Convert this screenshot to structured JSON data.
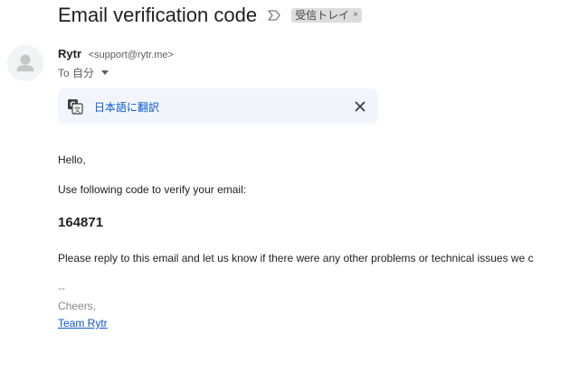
{
  "subject": "Email verification code",
  "label_chip": {
    "text": "受信トレイ",
    "close": "×"
  },
  "sender": {
    "name": "Rytr",
    "email": "<support@rytr.me>",
    "to_label": "To 自分"
  },
  "translate_bar": {
    "link_text": "日本語に翻訳",
    "icon": "translate-icon",
    "close_icon": "close-icon"
  },
  "message": {
    "greeting": "Hello,",
    "instruction": "Use following code to verify your email:",
    "code": "164871",
    "reply_note": "Please reply to this email and let us know if there were any other problems or technical issues we c",
    "sig_dash": "--",
    "sig_cheers": "Cheers,",
    "sig_team": "Team Rytr"
  },
  "colors": {
    "link_blue": "#0b57d0",
    "signature_link": "#1155cc",
    "translate_bg": "#f2f6fc",
    "chip_bg": "#dddddd"
  }
}
